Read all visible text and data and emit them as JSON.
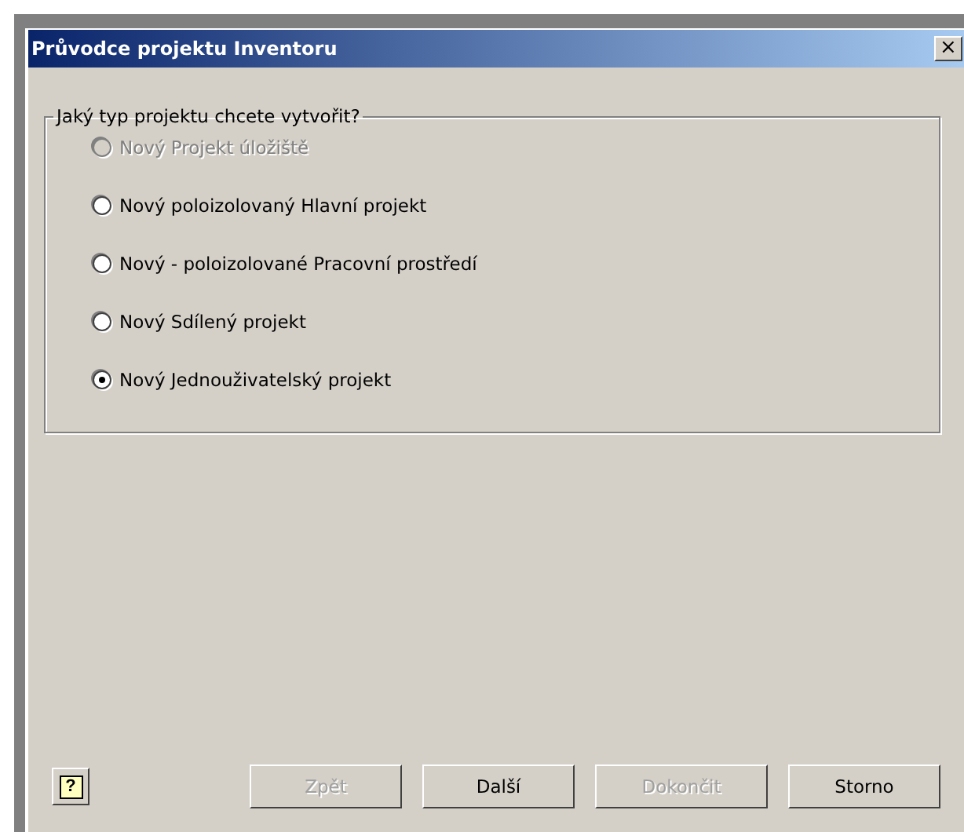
{
  "window": {
    "title": "Průvodce projektu Inventoru",
    "close": "×"
  },
  "group": {
    "title": "Jaký typ projektu chcete vytvořit?",
    "options": [
      {
        "label": "Nový Projekt úložiště",
        "selected": false,
        "disabled": true
      },
      {
        "label": "Nový poloizolovaný Hlavní projekt",
        "selected": false,
        "disabled": false
      },
      {
        "label": "Nový - poloizolované Pracovní prostředí",
        "selected": false,
        "disabled": false
      },
      {
        "label": "Nový Sdílený projekt",
        "selected": false,
        "disabled": false
      },
      {
        "label": "Nový Jednouživatelský projekt",
        "selected": true,
        "disabled": false
      }
    ]
  },
  "help": "?",
  "buttons": [
    {
      "label": "Zpět",
      "disabled": true
    },
    {
      "label": "Další",
      "disabled": false
    },
    {
      "label": "Dokončit",
      "disabled": true
    },
    {
      "label": "Storno",
      "disabled": false
    }
  ]
}
